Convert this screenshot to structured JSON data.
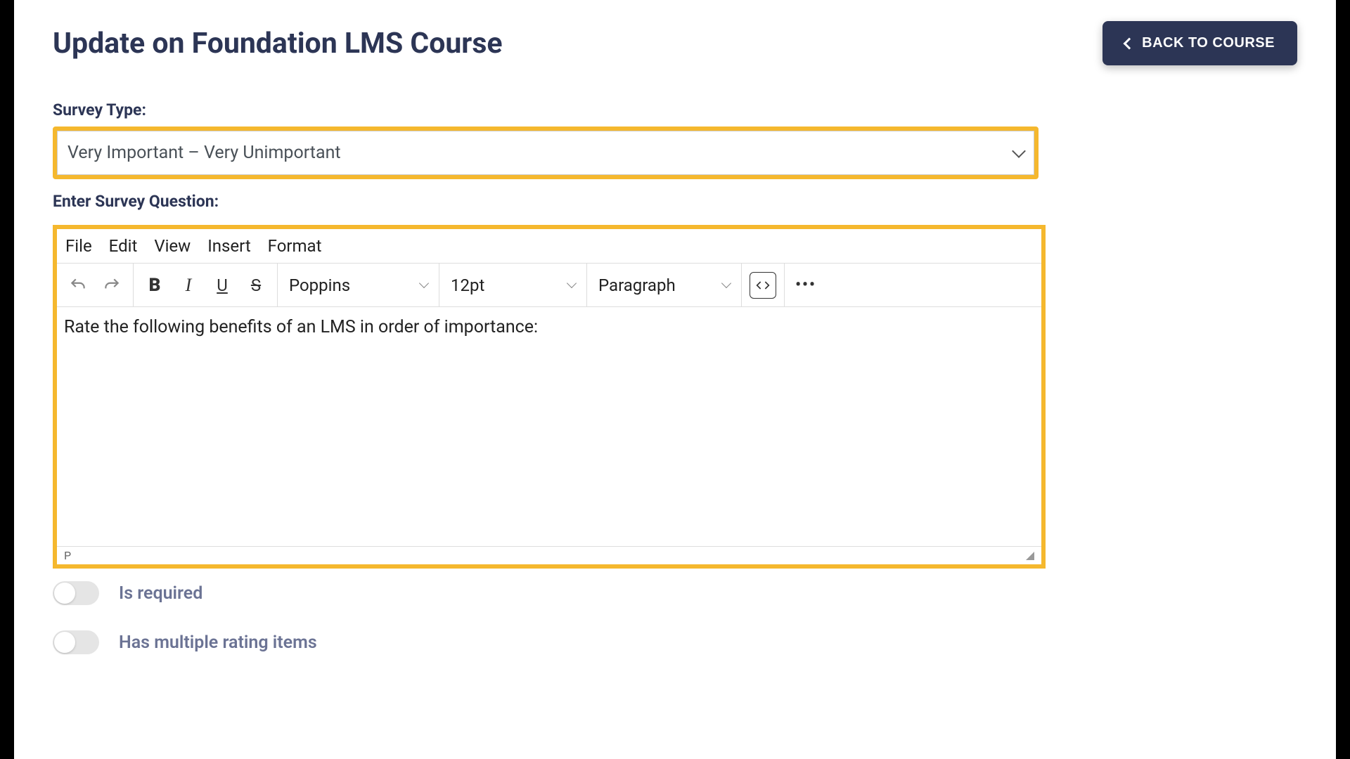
{
  "header": {
    "title": "Update on Foundation LMS Course",
    "back_button_label": "BACK TO COURSE"
  },
  "form": {
    "survey_type_label": "Survey Type:",
    "survey_type_value": "Very Important – Very Unimportant",
    "question_label": "Enter Survey Question:",
    "question_value": "Rate the following benefits of an LMS in order of importance:"
  },
  "editor": {
    "menus": {
      "file": "File",
      "edit": "Edit",
      "view": "View",
      "insert": "Insert",
      "format": "Format"
    },
    "toolbar": {
      "font_family": "Poppins",
      "font_size": "12pt",
      "block_format": "Paragraph"
    },
    "status_path": "P"
  },
  "toggles": {
    "is_required": {
      "label": "Is required",
      "value": false
    },
    "multiple_rating": {
      "label": "Has multiple rating items",
      "value": false
    }
  }
}
